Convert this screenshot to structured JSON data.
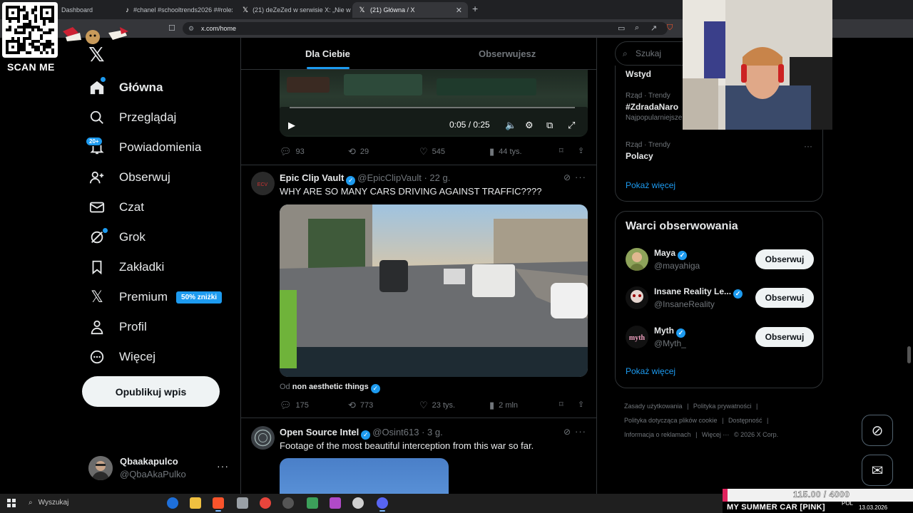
{
  "browser": {
    "tabs": [
      {
        "label": "Dashboard",
        "active": false
      },
      {
        "label": "#chanel #schooltrends2026 ##rolex",
        "active": false
      },
      {
        "label": "(21) deZeZed w serwisie X: „Nie wier",
        "active": false
      },
      {
        "label": "(21) Główna / X",
        "active": true
      }
    ],
    "url": "x.com/home"
  },
  "overlay": {
    "scan_label": "SCAN ME",
    "game_value": "115.00 / 4000",
    "game_title": "MY SUMMER CAR [PINK]"
  },
  "sidebar": {
    "nav": [
      {
        "label": "Główna",
        "icon": "home-icon"
      },
      {
        "label": "Przeglądaj",
        "icon": "search-icon"
      },
      {
        "label": "Powiadomienia",
        "icon": "bell-icon"
      },
      {
        "label": "Obserwuj",
        "icon": "follow-icon"
      },
      {
        "label": "Czat",
        "icon": "mail-icon"
      },
      {
        "label": "Grok",
        "icon": "grok-icon"
      },
      {
        "label": "Zakładki",
        "icon": "bookmark-icon"
      },
      {
        "label": "Premium",
        "icon": "x-icon"
      },
      {
        "label": "Profil",
        "icon": "profile-icon"
      },
      {
        "label": "Więcej",
        "icon": "more-circle-icon"
      }
    ],
    "notif_badge": "20+",
    "premium_badge": "50% zniżki",
    "post_button": "Opublikuj wpis",
    "account": {
      "name": "Qbaakapulco",
      "handle": "@QbaAkaPulko"
    }
  },
  "feed": {
    "tabs": [
      "Dla Ciebie",
      "Obserwujesz"
    ],
    "video_time": "0:05 / 0:25",
    "posts": [
      {
        "stats": {
          "replies": "93",
          "reposts": "29",
          "likes": "545",
          "views": "44 tys."
        }
      },
      {
        "name": "Epic Clip Vault",
        "handle": "@EpicClipVault",
        "time": "· 22 g.",
        "text": "WHY ARE SO MANY CARS DRIVING AGAINST TRAFFIC????",
        "from_prefix": "Od",
        "from_name": "non aesthetic things",
        "stats": {
          "replies": "175",
          "reposts": "773",
          "likes": "23 tys.",
          "views": "2 mln"
        }
      },
      {
        "name": "Open Source Intel",
        "handle": "@Osint613",
        "time": "· 3 g.",
        "text": "Footage of the most beautiful interception from this war so far."
      }
    ]
  },
  "right": {
    "search_placeholder": "Szukaj",
    "trends": [
      {
        "meta": "",
        "title": "Wstyd",
        "sub": ""
      },
      {
        "meta": "Rząd · Trendy",
        "title": "#ZdradaNaro",
        "sub": "Najpopularniejsze"
      },
      {
        "meta": "Rząd · Trendy",
        "title": "Polacy",
        "sub": ""
      }
    ],
    "show_more": "Pokaż więcej",
    "who_title": "Warci obserwowania",
    "who": [
      {
        "name": "Maya",
        "handle": "@mayahiga",
        "button": "Obserwuj"
      },
      {
        "name": "Insane Reality Le...",
        "handle": "@InsaneReality",
        "button": "Obserwuj"
      },
      {
        "name": "Myth",
        "handle": "@Myth_",
        "button": "Obserwuj"
      }
    ],
    "footer": [
      "Zasady użytkowania",
      "|",
      "Polityka prywatności",
      "|",
      "Polityka dotycząca plików cookie",
      "|",
      "Dostępność",
      "|",
      "Informacja o reklamach",
      "|",
      "Więcej ···",
      "© 2026 X Corp."
    ]
  },
  "taskbar": {
    "search": "Wyszukaj",
    "lang": "POL",
    "date": "13.03.2026"
  },
  "colors": {
    "accent": "#1d9bf0",
    "bg": "#000000",
    "border": "#2f3336",
    "muted": "#71767b"
  }
}
